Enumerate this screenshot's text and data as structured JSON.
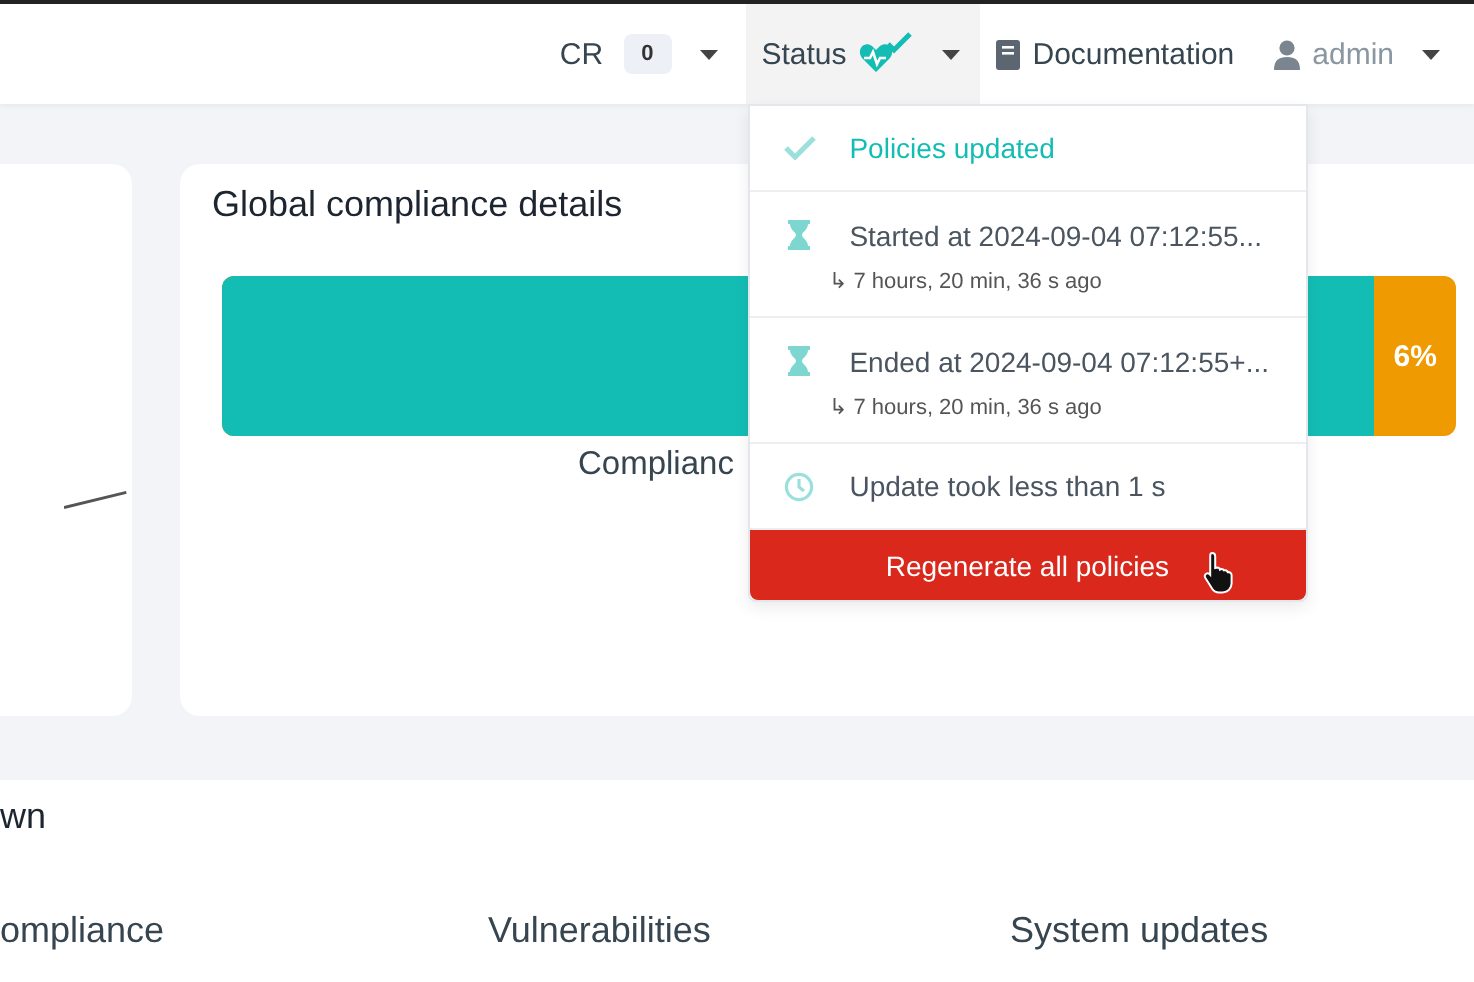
{
  "navbar": {
    "items": [
      {
        "kind": "cr",
        "label": "CR",
        "badge": "0"
      },
      {
        "kind": "status",
        "label": "Status",
        "open": true
      },
      {
        "kind": "link",
        "label": "Documentation"
      },
      {
        "kind": "user",
        "label": "admin"
      }
    ]
  },
  "status_menu": {
    "items": [
      {
        "kind": "success",
        "text": "Policies updated"
      },
      {
        "kind": "time",
        "text": "Started at 2024-09-04 07:12:55...",
        "sub": "↳ 7 hours, 20 min, 36 s ago"
      },
      {
        "kind": "time",
        "text": "Ended at 2024-09-04 07:12:55+...",
        "sub": "↳ 7 hours, 20 min, 36 s ago"
      },
      {
        "kind": "duration",
        "text": "Update took less than 1 s"
      }
    ],
    "button": "Regenerate all policies"
  },
  "compliance_card": {
    "title": "Global compliance details",
    "bar": {
      "level": 0.934,
      "label": "6%"
    },
    "caption": "Complianc"
  },
  "breakdown": {
    "title": "wn",
    "columns": [
      "ompliance",
      "Vulnerabilities",
      "System updates"
    ]
  }
}
